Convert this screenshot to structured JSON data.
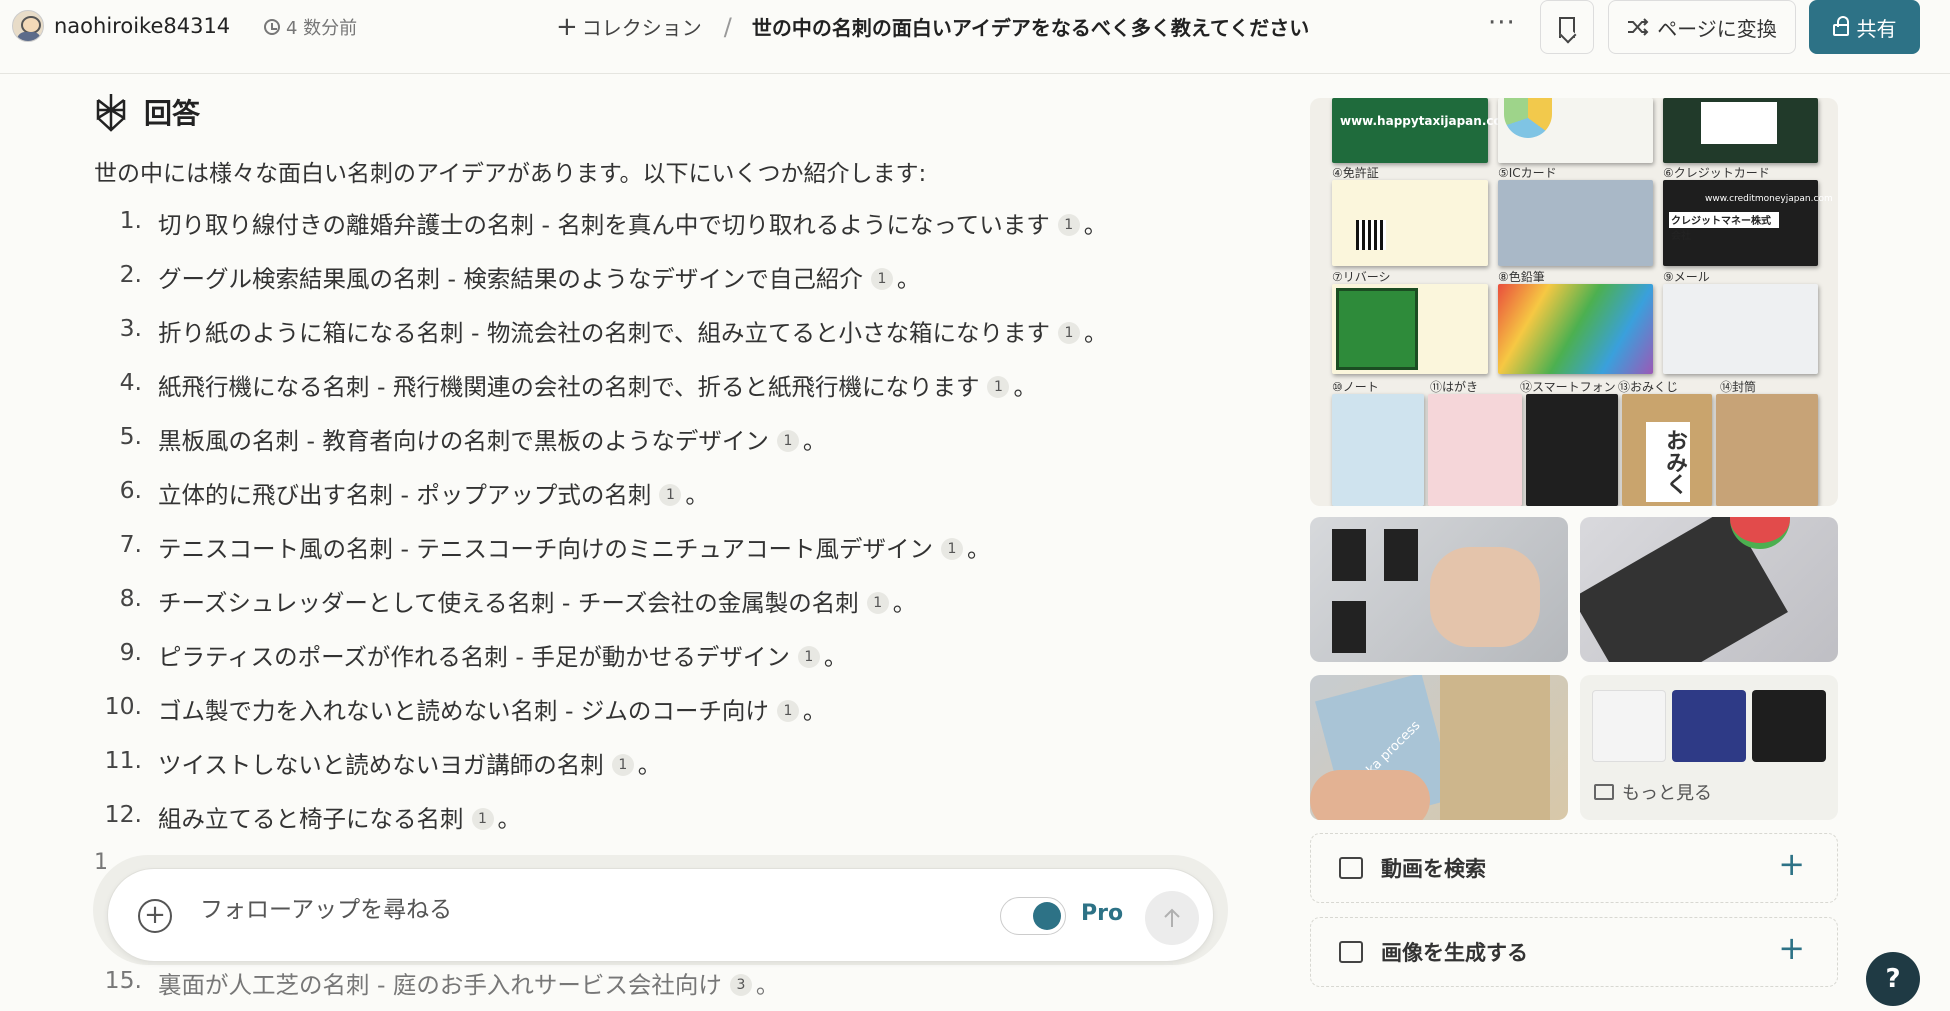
{
  "header": {
    "username": "naohiroike84314",
    "time": "4 数分前",
    "collection_label": "コレクション",
    "separator": "/",
    "thread_title": "世の中の名刺の面白いアイデアをなるべく多く教えてください",
    "more_label": "···",
    "convert_label": "ページに変換",
    "share_label": "共有"
  },
  "answer": {
    "heading": "回答",
    "intro": "世の中には様々な面白い名刺のアイデアがあります。以下にいくつか紹介します:",
    "items": [
      {
        "num": "1.",
        "text": "切り取り線付きの離婚弁護士の名刺 - 名刺を真ん中で切り取れるようになっています",
        "cite": "1",
        "end": "。"
      },
      {
        "num": "2.",
        "text": "グーグル検索結果風の名刺 - 検索結果のようなデザインで自己紹介",
        "cite": "1",
        "end": "。"
      },
      {
        "num": "3.",
        "text": "折り紙のように箱になる名刺 - 物流会社の名刺で、組み立てると小さな箱になります",
        "cite": "1",
        "end": "。"
      },
      {
        "num": "4.",
        "text": "紙飛行機になる名刺 - 飛行機関連の会社の名刺で、折ると紙飛行機になります",
        "cite": "1",
        "end": "。"
      },
      {
        "num": "5.",
        "text": "黒板風の名刺 - 教育者向けの名刺で黒板のようなデザイン",
        "cite": "1",
        "end": "。"
      },
      {
        "num": "6.",
        "text": "立体的に飛び出す名刺 - ポップアップ式の名刺",
        "cite": "1",
        "end": "。"
      },
      {
        "num": "7.",
        "text": "テニスコート風の名刺 - テニスコーチ向けのミニチュアコート風デザイン",
        "cite": "1",
        "end": "。"
      },
      {
        "num": "8.",
        "text": "チーズシュレッダーとして使える名刺 - チーズ会社の金属製の名刺",
        "cite": "1",
        "end": "。"
      },
      {
        "num": "9.",
        "text": "ピラティスのポーズが作れる名刺 - 手足が動かせるデザイン",
        "cite": "1",
        "end": "。"
      },
      {
        "num": "10.",
        "text": "ゴム製で力を入れないと読めない名刺 - ジムのコーチ向け",
        "cite": "1",
        "end": "。"
      },
      {
        "num": "11.",
        "text": "ツイストしないと読めないヨガ講師の名刺",
        "cite": "1",
        "end": "。"
      },
      {
        "num": "12.",
        "text": "組み立てると椅子になる名刺",
        "cite": "1",
        "end": "。"
      }
    ],
    "partial_num": "1",
    "last_item": {
      "num": "15.",
      "text": "裏面が人工芝の名刺 - 庭のお手入れサービス会社向け",
      "cite": "3",
      "end": "。"
    }
  },
  "followup": {
    "placeholder": "フォローアップを尋ねる",
    "pro_label": "Pro",
    "pro_enabled": true
  },
  "sidebar": {
    "gallery_texts": {
      "url1": "www.happytaxijapan.com",
      "url2": "www.creditmoneyjapan.com",
      "company": "クレジットマネー株式会社",
      "labels": [
        "④免許証",
        "⑤ICカード",
        "⑥クレジットカード",
        "⑦リバーシ",
        "⑧色鉛筆",
        "⑨メール",
        "⑩ノート",
        "⑪はがき",
        "⑫スマートフォン",
        "⑬おみくじ",
        "⑭封筒"
      ],
      "omikuji": "おみく",
      "process": "bunka process"
    },
    "more_label": "もっと見る",
    "actions": [
      {
        "label": "動画を検索",
        "icon": "film-icon"
      },
      {
        "label": "画像を生成する",
        "icon": "image-generate-icon"
      }
    ]
  },
  "help_label": "?",
  "colors": {
    "accent": "#2d7286",
    "background": "#fbfbf8",
    "help": "#1f3a44"
  }
}
